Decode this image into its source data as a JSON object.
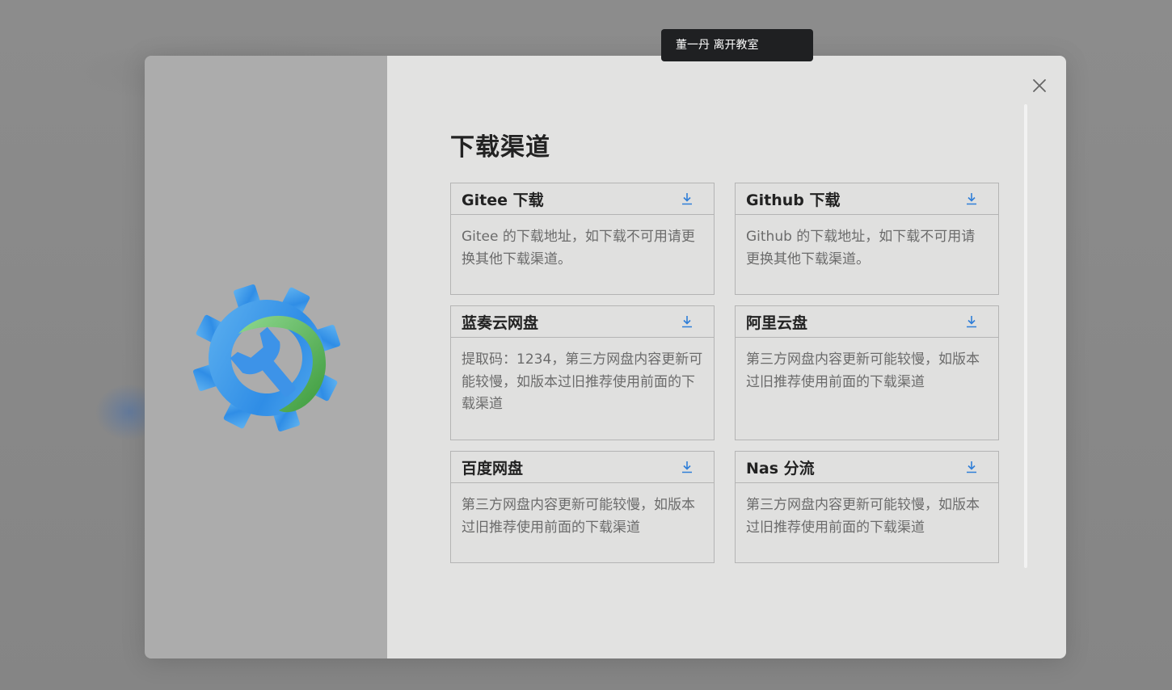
{
  "toast": {
    "text": "董一丹 离开教室"
  },
  "dialog": {
    "title": "下载渠道",
    "close_icon": "close-icon",
    "download_icon": "download-icon",
    "accent_color": "#2f7ed8",
    "channels": [
      {
        "name": "Gitee 下载",
        "desc": "Gitee 的下载地址，如下载不可用请更换其他下载渠道。"
      },
      {
        "name": "Github 下载",
        "desc": "Github 的下载地址，如下载不可用请更换其他下载渠道。"
      },
      {
        "name": "蓝奏云网盘",
        "desc": "提取码：1234，第三方网盘内容更新可能较慢，如版本过旧推荐使用前面的下载渠道"
      },
      {
        "name": "阿里云盘",
        "desc": "第三方网盘内容更新可能较慢，如版本过旧推荐使用前面的下载渠道"
      },
      {
        "name": "百度网盘",
        "desc": "第三方网盘内容更新可能较慢，如版本过旧推荐使用前面的下载渠道"
      },
      {
        "name": "Nas 分流",
        "desc": "第三方网盘内容更新可能较慢，如版本过旧推荐使用前面的下载渠道"
      }
    ]
  },
  "logo": {
    "icon": "gear-wrench-logo-icon"
  }
}
